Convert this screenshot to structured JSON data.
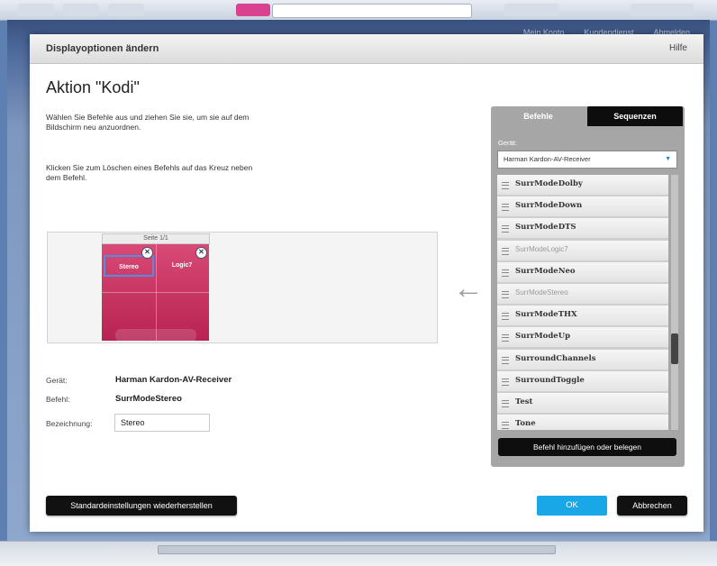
{
  "background": {
    "nav_links": [
      "Mein Konto",
      "Kundendienst",
      "Abmelden"
    ]
  },
  "dialog": {
    "title": "Displayoptionen ändern",
    "help": "Hilfe",
    "action_title": "Aktion \"Kodi\"",
    "instruction_1": "Wählen Sie Befehle aus und ziehen Sie sie, um sie auf dem Bildschirm neu anzuordnen.",
    "instruction_2": "Klicken Sie zum Löschen eines Befehls auf das Kreuz neben dem Befehl.",
    "preview": {
      "page_label": "Seite 1/1",
      "buttons": [
        "Stereo",
        "Logic7"
      ],
      "selected_index": 0,
      "delete_glyph": "✕"
    },
    "details": {
      "device_label": "Gerät:",
      "device_value": "Harman Kardon-AV-Receiver",
      "command_label": "Befehl:",
      "command_value": "SurrModeStereo",
      "name_label": "Bezeichnung:",
      "name_value": "Stereo"
    },
    "buttons": {
      "restore_defaults": "Standardeinstellungen wiederherstellen",
      "ok": "OK",
      "cancel": "Abbrechen"
    },
    "panel": {
      "tab_commands": "Befehle",
      "tab_sequences": "Sequenzen",
      "device_label": "Gerät:",
      "device_selected": "Harman Kardon-AV-Receiver",
      "commands": [
        {
          "label": "SurrModeDolby",
          "dim": false
        },
        {
          "label": "SurrModeDown",
          "dim": false
        },
        {
          "label": "SurrModeDTS",
          "dim": false
        },
        {
          "label": "SurrModeLogic7",
          "dim": true
        },
        {
          "label": "SurrModeNeo",
          "dim": false
        },
        {
          "label": "SurrModeStereo",
          "dim": true
        },
        {
          "label": "SurrModeTHX",
          "dim": false
        },
        {
          "label": "SurrModeUp",
          "dim": false
        },
        {
          "label": "SurroundChannels",
          "dim": false
        },
        {
          "label": "SurroundToggle",
          "dim": false
        },
        {
          "label": "Test",
          "dim": false
        },
        {
          "label": "Tone",
          "dim": false
        }
      ],
      "add_button": "Befehl hinzufügen oder belegen"
    }
  },
  "colors": {
    "accent_ok": "#19a7e8",
    "screen_pink": "#c92f5f",
    "selected_outline": "#4f8ee0"
  }
}
